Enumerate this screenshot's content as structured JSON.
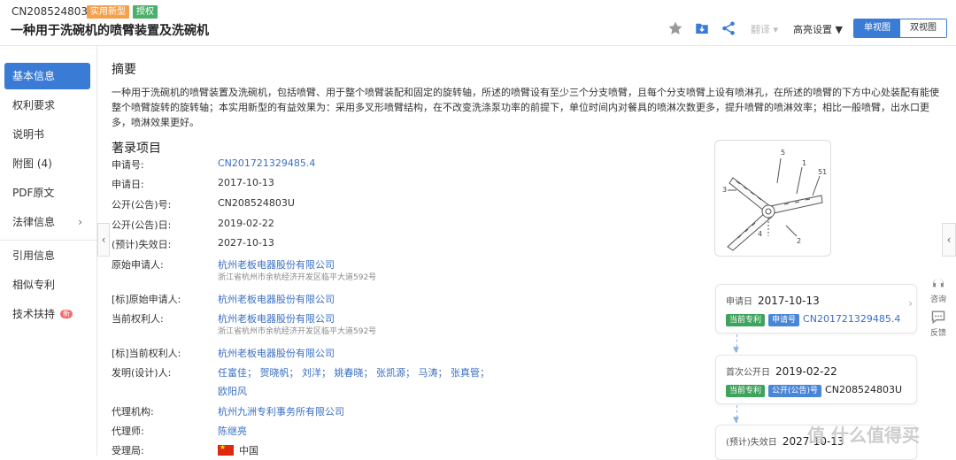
{
  "header": {
    "pub_number": "CN208524803U",
    "type_badge": "实用新型",
    "status_badge": "授权",
    "title": "一种用于洗碗机的喷臂装置及洗碗机",
    "translate": "翻译",
    "advanced_settings": "高亮设置",
    "view_single": "单视图",
    "view_double": "双视图"
  },
  "sidebar": {
    "items": [
      {
        "label": "基本信息"
      },
      {
        "label": "权利要求"
      },
      {
        "label": "说明书"
      },
      {
        "label": "附图 (4)"
      },
      {
        "label": "PDF原文"
      },
      {
        "label": "法律信息"
      },
      {
        "label": "引用信息"
      },
      {
        "label": "相似专利"
      },
      {
        "label": "技术扶持"
      }
    ],
    "new_tag": "新"
  },
  "abstract": {
    "title": "摘要",
    "text": "一种用于洗碗机的喷臂装置及洗碗机，包括喷臂、用于整个喷臂装配和固定的旋转轴，所述的喷臂设有至少三个分支喷臂，且每个分支喷臂上设有喷淋孔，在所述的喷臂的下方中心处装配有能使整个喷臂旋转的旋转轴；本实用新型的有益效果为：采用多叉形喷臂结构，在不改变洗涤泵功率的前提下，单位时间内对餐具的喷淋次数更多，提升喷臂的喷淋效率；相比一般喷臂，出水口更多，喷淋效果更好。"
  },
  "biblio": {
    "title": "著录项目",
    "app_no_label": "申请号:",
    "app_no": "CN201721329485.4",
    "app_date_label": "申请日:",
    "app_date": "2017-10-13",
    "pub_no_label": "公开(公告)号:",
    "pub_no": "CN208524803U",
    "pub_date_label": "公开(公告)日:",
    "pub_date": "2019-02-22",
    "expiry_label": "(预计)失效日:",
    "expiry": "2027-10-13",
    "orig_applicant_label": "原始申请人:",
    "orig_applicant": "杭州老板电器股份有限公司",
    "orig_applicant_addr": "浙江省杭州市余杭经济开发区临平大道592号",
    "std_orig_applicant_label": "[标]原始申请人:",
    "std_orig_applicant": "杭州老板电器股份有限公司",
    "assignee_label": "当前权利人:",
    "assignee": "杭州老板电器股份有限公司",
    "assignee_addr": "浙江省杭州市余杭经济开发区临平大道592号",
    "std_assignee_label": "[标]当前权利人:",
    "std_assignee": "杭州老板电器股份有限公司",
    "inventors_label": "发明(设计)人:",
    "inventors_line1": "任富佳；  贺晓帆；  刘洋；  姚春晓；  张凯源；  马涛；  张真管；",
    "inventors_line2": "欧阳风",
    "agency_label": "代理机构:",
    "agency": "杭州九洲专利事务所有限公司",
    "agent_label": "代理师:",
    "agent": "陈继亮",
    "office_label": "受理局:",
    "office": "中国"
  },
  "figure_labels": [
    "5",
    "1",
    "51",
    "3",
    "4",
    "2"
  ],
  "timeline": {
    "card1": {
      "date_label": "申请日",
      "date": "2017-10-13",
      "tag1": "当前专利",
      "tag2": "申请号",
      "number": "CN201721329485.4"
    },
    "card2": {
      "date_label": "首次公开日",
      "date": "2019-02-22",
      "tag1": "当前专利",
      "tag2": "公开(公告)号",
      "number": "CN208524803U"
    },
    "card3": {
      "date_label": "(预计)失效日",
      "date": "2027-10-13"
    }
  },
  "float": {
    "consult": "咨询",
    "feedback": "反馈"
  },
  "watermark": "值 什么值得买",
  "colors": {
    "accent": "#3a7bd5",
    "badge_orange": "#f5a04c",
    "badge_green": "#4caf6a",
    "link": "#3a6fc4"
  }
}
